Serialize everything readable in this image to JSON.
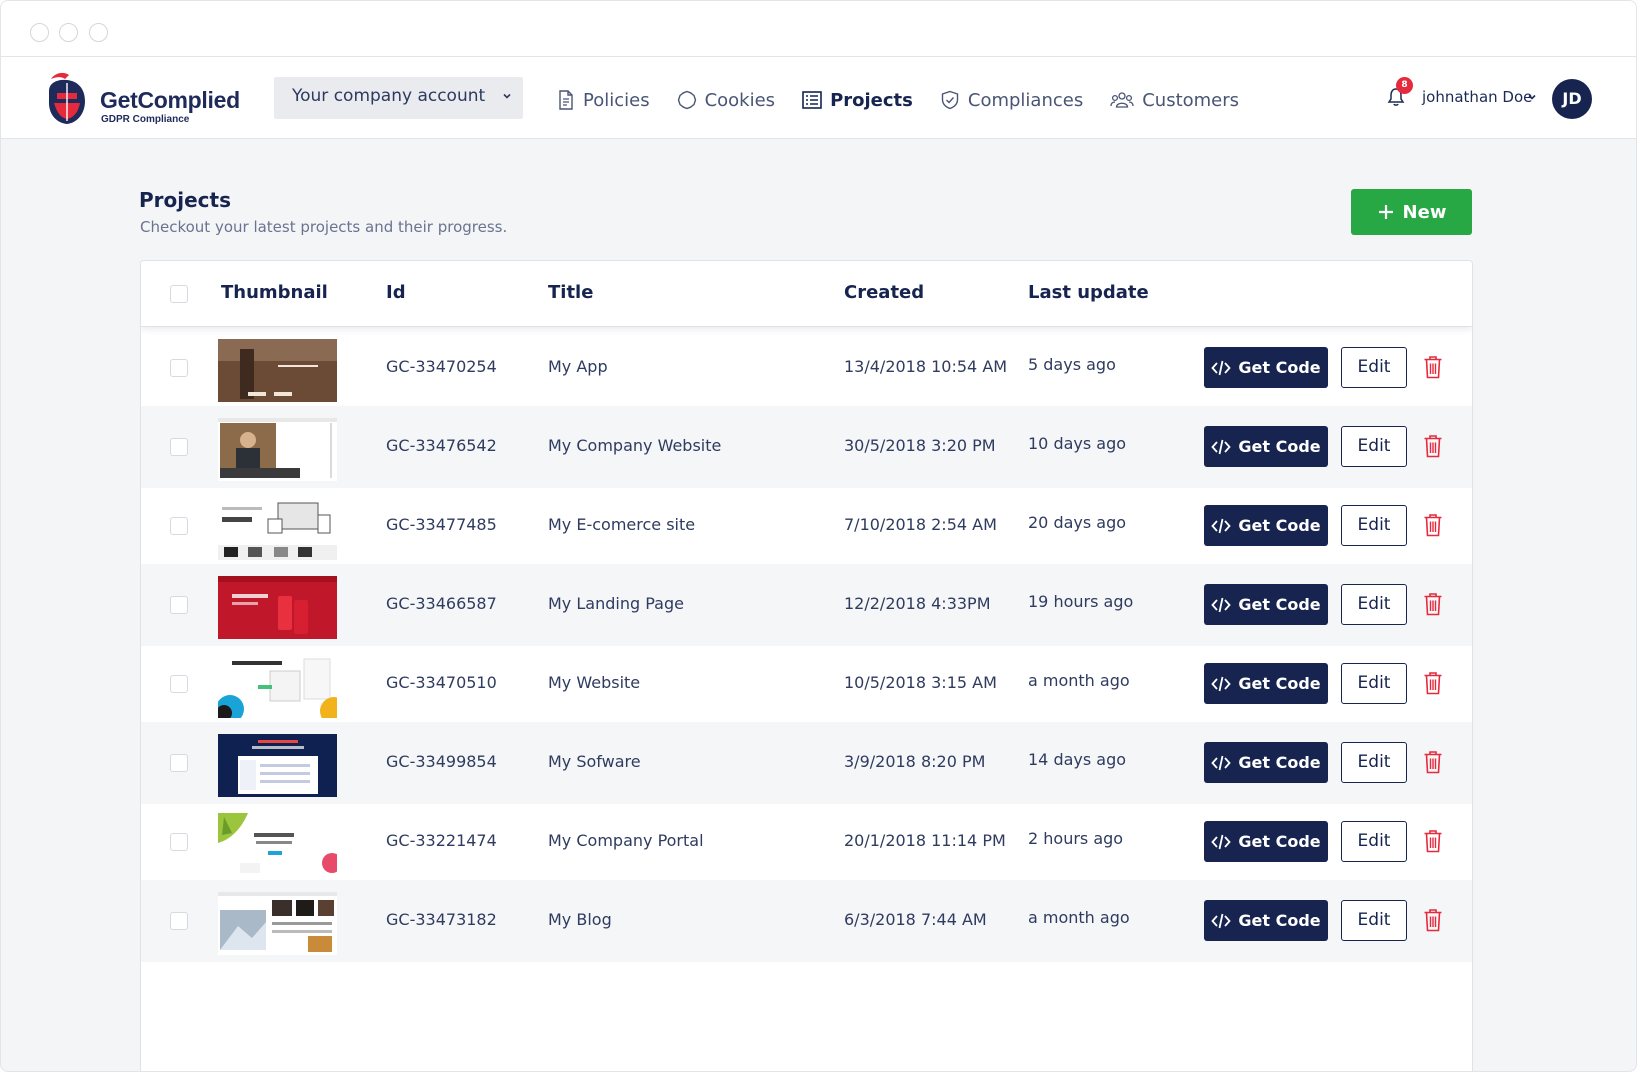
{
  "app": {
    "brand_name": "GetComplied",
    "brand_tagline": "GDPR Compliance",
    "colors": {
      "navy": "#16244f",
      "green": "#28a745",
      "red": "#e42a3c",
      "bg": "#f4f5f7"
    }
  },
  "header": {
    "account_select": {
      "value": "Your company account",
      "icon": "chevron-down-icon"
    },
    "nav": [
      {
        "label": "Policies",
        "icon": "document-icon",
        "active": false
      },
      {
        "label": "Cookies",
        "icon": "cookie-icon",
        "active": false
      },
      {
        "label": "Projects",
        "icon": "list-icon",
        "active": true
      },
      {
        "label": "Compliances",
        "icon": "shield-check-icon",
        "active": false
      },
      {
        "label": "Customers",
        "icon": "users-icon",
        "active": false
      }
    ],
    "notifications": {
      "count": "8",
      "icon": "bell-icon"
    },
    "user": {
      "name": "johnathan Doe",
      "initials": "JD"
    }
  },
  "page": {
    "title": "Projects",
    "subtitle": "Checkout your latest projects and their progress.",
    "new_button": "New"
  },
  "table": {
    "columns": {
      "thumbnail": "Thumbnail",
      "id": "Id",
      "title": "Title",
      "created": "Created",
      "last_update": "Last update"
    },
    "actions": {
      "get_code": "Get Code",
      "edit": "Edit"
    },
    "rows": [
      {
        "id": "GC-33470254",
        "title": "My App",
        "created": "13/4/2018 10:54 AM",
        "last_update": "5 days ago",
        "thumb": "app"
      },
      {
        "id": "GC-33476542",
        "title": "My Company Website",
        "created": "30/5/2018 3:20 PM",
        "last_update": "10 days ago",
        "thumb": "company"
      },
      {
        "id": "GC-33477485",
        "title": "My E-comerce site",
        "created": "7/10/2018 2:54 AM",
        "last_update": "20 days ago",
        "thumb": "ecommerce"
      },
      {
        "id": "GC-33466587",
        "title": "My Landing Page",
        "created": "12/2/2018 4:33PM",
        "last_update": "19 hours ago",
        "thumb": "landing"
      },
      {
        "id": "GC-33470510",
        "title": "My Website",
        "created": "10/5/2018 3:15 AM",
        "last_update": "a month ago",
        "thumb": "website"
      },
      {
        "id": "GC-33499854",
        "title": "My Sofware",
        "created": "3/9/2018 8:20 PM",
        "last_update": "14 days ago",
        "thumb": "software"
      },
      {
        "id": "GC-33221474",
        "title": "My Company Portal",
        "created": "20/1/2018 11:14 PM",
        "last_update": "2 hours ago",
        "thumb": "portal"
      },
      {
        "id": "GC-33473182",
        "title": "My Blog",
        "created": "6/3/2018 7:44 AM",
        "last_update": "a month ago",
        "thumb": "blog"
      }
    ]
  }
}
